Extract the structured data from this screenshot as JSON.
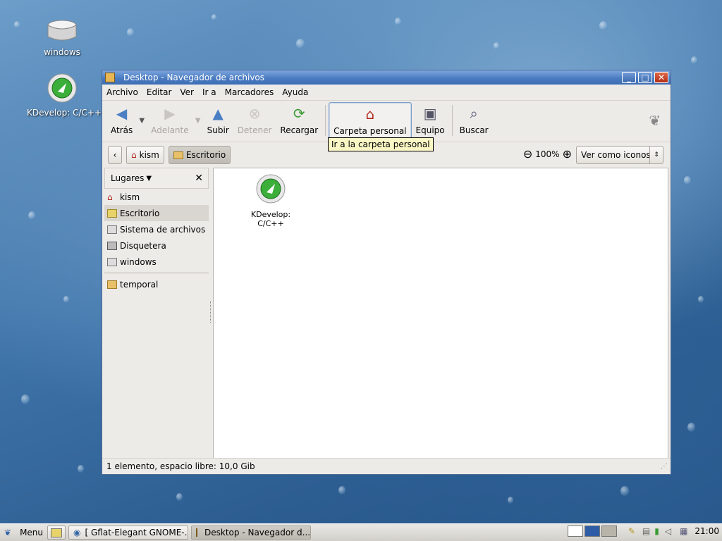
{
  "desktop": {
    "icons": [
      {
        "label": "windows"
      },
      {
        "label": "KDevelop: C/C++"
      }
    ]
  },
  "window": {
    "title": "Desktop - Navegador de archivos",
    "menu": [
      "Archivo",
      "Editar",
      "Ver",
      "Ir a",
      "Marcadores",
      "Ayuda"
    ],
    "toolbar": {
      "back": "Atrás",
      "forward": "Adelante",
      "up": "Subir",
      "stop": "Detener",
      "reload": "Recargar",
      "home": "Carpeta personal",
      "computer": "Equipo",
      "search": "Buscar"
    },
    "tooltip": "Ir a la carpeta personal",
    "path": [
      "kism",
      "Escritorio"
    ],
    "zoom": "100%",
    "view_mode": "Ver como iconos",
    "sidebar": {
      "header": "Lugares",
      "items": [
        "kism",
        "Escritorio",
        "Sistema de archivos",
        "Disquetera",
        "windows"
      ],
      "bookmarks": [
        "temporal"
      ],
      "selected": "Escritorio"
    },
    "files": [
      {
        "label": "KDevelop: C/C++"
      }
    ],
    "status": "1 elemento, espacio libre: 10,0 Gib"
  },
  "taskbar": {
    "menu_label": "Menu",
    "tasks": [
      "[ Gflat-Elegant GNOME-...",
      "Desktop - Navegador d..."
    ],
    "clock": "21:00"
  },
  "colors": {
    "titlebar": "#4b7cc2",
    "tooltip_bg": "#fbf7c5",
    "selection": "#d9d6d1"
  }
}
